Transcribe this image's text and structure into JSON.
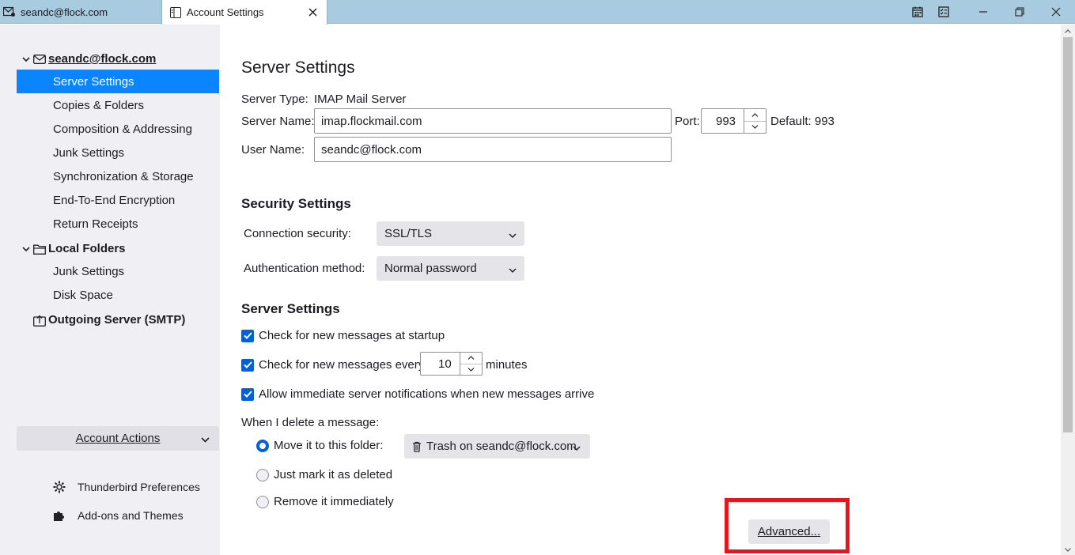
{
  "tabs": [
    {
      "label": "seandc@flock.com",
      "icon": "mail-icon"
    },
    {
      "label": "Account Settings",
      "icon": "settings-tab-icon"
    }
  ],
  "sidebar": {
    "account": "seandc@flock.com",
    "account_items": [
      "Server Settings",
      "Copies & Folders",
      "Composition & Addressing",
      "Junk Settings",
      "Synchronization & Storage",
      "End-To-End Encryption",
      "Return Receipts"
    ],
    "local_folders": "Local Folders",
    "local_items": [
      "Junk Settings",
      "Disk Space"
    ],
    "outgoing": "Outgoing Server (SMTP)",
    "account_actions": "Account Actions",
    "preferences": "Thunderbird Preferences",
    "addons": "Add-ons and Themes"
  },
  "main": {
    "title": "Server Settings",
    "server_type_label": "Server Type:",
    "server_type_value": "IMAP Mail Server",
    "server_name_label": "Server Name:",
    "server_name_value": "imap.flockmail.com",
    "port_label": "Port:",
    "port_value": "993",
    "port_default": "Default: 993",
    "user_name_label": "User Name:",
    "user_name_value": "seandc@flock.com",
    "security_heading": "Security Settings",
    "connection_security_label": "Connection security:",
    "connection_security_value": "SSL/TLS",
    "auth_method_label": "Authentication method:",
    "auth_method_value": "Normal password",
    "server_settings_heading": "Server Settings",
    "check_startup": "Check for new messages at startup",
    "check_every": "Check for new messages every",
    "check_every_value": "10",
    "minutes": "minutes",
    "allow_notifications": "Allow immediate server notifications when new messages arrive",
    "delete_label": "When I delete a message:",
    "move_to_folder": "Move it to this folder:",
    "trash_folder": "Trash on seandc@flock.com",
    "mark_deleted": "Just mark it as deleted",
    "remove_immediately": "Remove it immediately",
    "advanced_button": "Advanced..."
  },
  "colors": {
    "accent": "#0060df",
    "selection": "#0a84ff",
    "highlight": "#e8141e",
    "titlebar": "#a8cbe0"
  }
}
